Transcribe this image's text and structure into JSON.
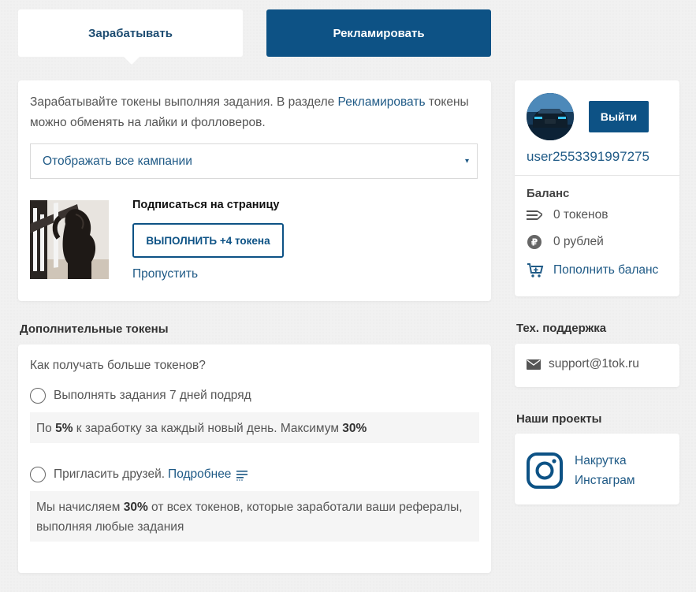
{
  "tabs": {
    "earn": "Зарабатывать",
    "advertise": "Рекламировать"
  },
  "intro": {
    "text_before": "Зарабатывайте токены выполняя задания. В разделе ",
    "link": "Рекламировать",
    "text_after": " токены можно обменять на лайки и фолловеров."
  },
  "campaign_filter": {
    "selected": "Отображать все кампании",
    "caret": "▾"
  },
  "task": {
    "title": "Подписаться на страницу",
    "button": "ВЫПОЛНИТЬ +4 токена",
    "skip": "Пропустить"
  },
  "extra_tokens": {
    "title": "Дополнительные токены",
    "question": "Как получать больше токенов?",
    "option1": {
      "label": "Выполнять задания 7 дней подряд",
      "note_prefix": "По ",
      "note_pct": "5%",
      "note_middle": " к заработку за каждый новый день. Максимум ",
      "note_max": "30%"
    },
    "option2": {
      "label": "Пригласить друзей. ",
      "more_link": "Подробнее",
      "note_prefix": "Мы начисляем ",
      "note_pct": "30%",
      "note_suffix": " от всех токенов, которые заработали ваши рефералы, выполняя любые задания"
    }
  },
  "user": {
    "logout": "Выйти",
    "username": "user2553391997275",
    "balance_title": "Баланс",
    "tokens": "0 токенов",
    "rubles": "0 рублей",
    "topup": "Пополнить баланс"
  },
  "support": {
    "title": "Тех. поддержка",
    "email": "support@1tok.ru"
  },
  "projects": {
    "title": "Наши проекты",
    "item_line1": "Накрутка",
    "item_line2": "Инстаграм"
  },
  "colors": {
    "brand": "#0d5285",
    "link": "#1f5a86",
    "background": "#f1f1f1"
  }
}
